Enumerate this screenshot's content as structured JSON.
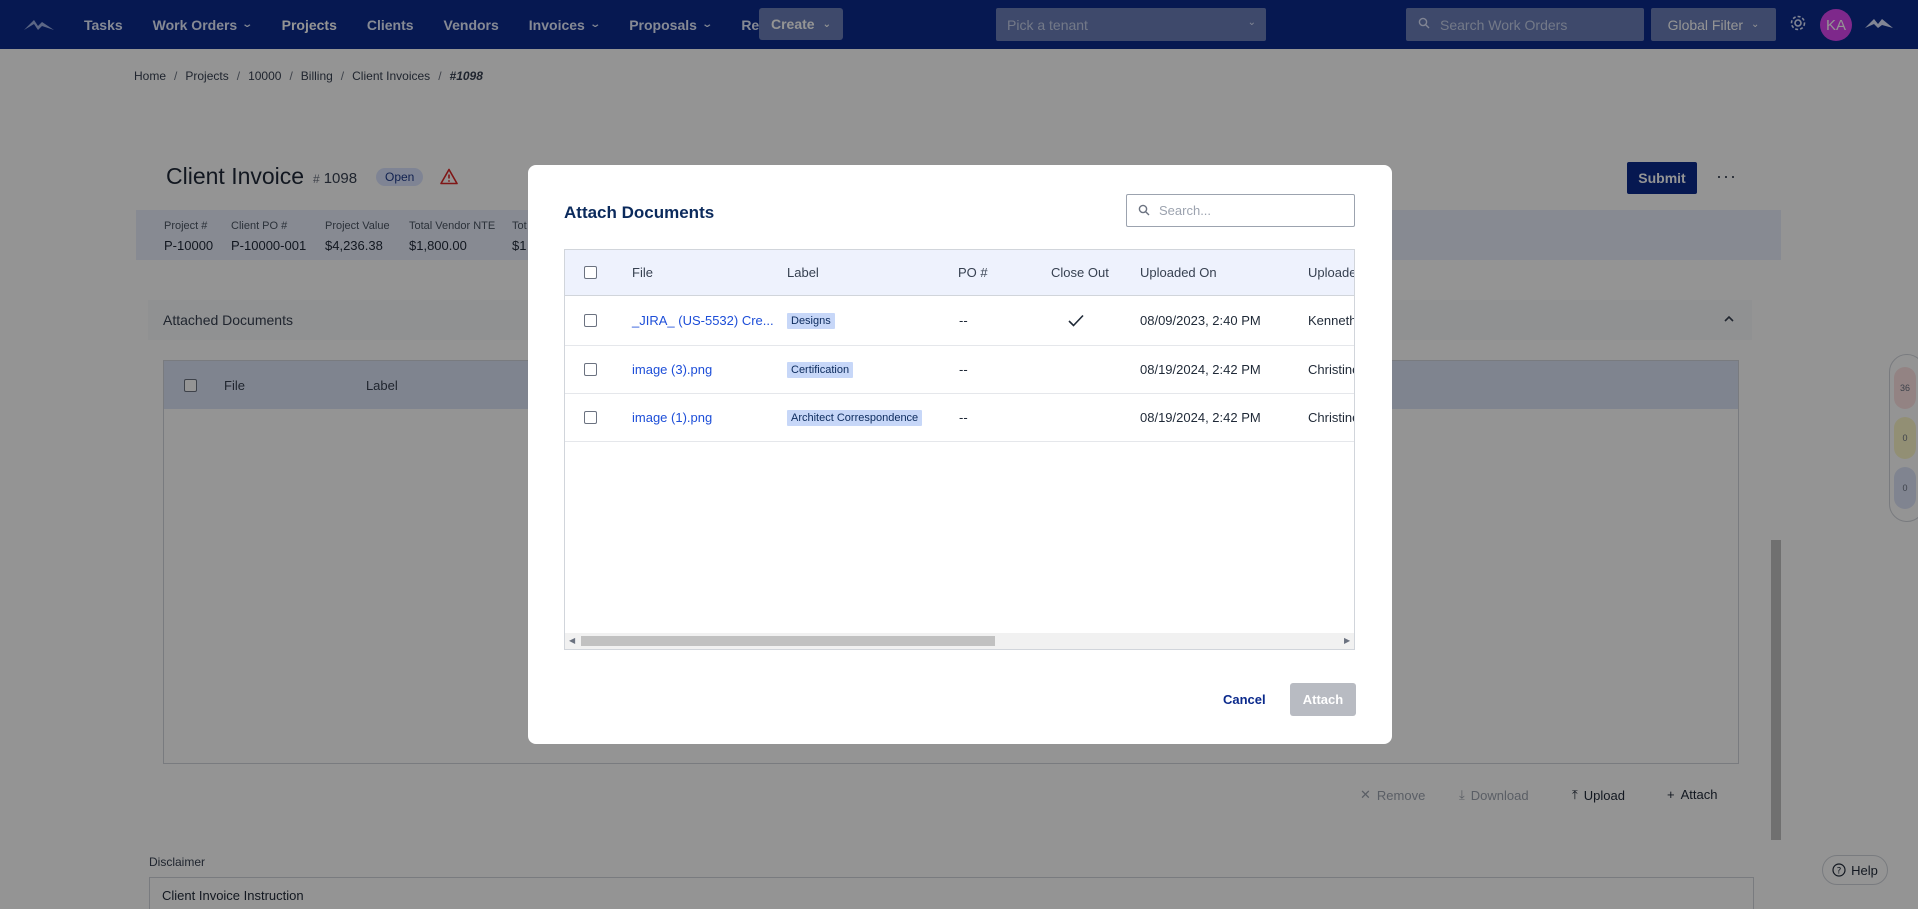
{
  "nav": {
    "items": [
      "Tasks",
      "Work Orders",
      "Projects",
      "Clients",
      "Vendors",
      "Invoices",
      "Proposals",
      "Reports"
    ],
    "create_label": "Create",
    "tenant_placeholder": "Pick a tenant",
    "search_placeholder": "Search Work Orders",
    "global_filter_label": "Global Filter",
    "avatar_initials": "KA"
  },
  "breadcrumb": [
    "Home",
    "Projects",
    "10000",
    "Billing",
    "Client Invoices",
    "#1098"
  ],
  "invoice": {
    "title": "Client Invoice",
    "hash": "#",
    "number": "1098",
    "status": "Open",
    "submit_label": "Submit",
    "more_label": "···"
  },
  "summary": [
    {
      "label": "Project #",
      "value": "P-10000"
    },
    {
      "label": "Client PO #",
      "value": "P-10000-001"
    },
    {
      "label": "Project Value",
      "value": "$4,236.38"
    },
    {
      "label": "Total Vendor NTE",
      "value": "$1,800.00"
    },
    {
      "label": "Tot",
      "value": "$1"
    }
  ],
  "attached": {
    "section_title": "Attached Documents",
    "columns": [
      "File",
      "Label"
    ],
    "actions": {
      "remove": "Remove",
      "download": "Download",
      "upload": "Upload",
      "attach": "Attach"
    }
  },
  "disclaimer": {
    "label": "Disclaimer",
    "value": "Client Invoice Instruction"
  },
  "help_label": "Help",
  "side_widget": [
    "36",
    "0",
    "0"
  ],
  "modal": {
    "title": "Attach Documents",
    "search_placeholder": "Search...",
    "columns": [
      "File",
      "Label",
      "PO #",
      "Close Out",
      "Uploaded On",
      "Uploade"
    ],
    "rows": [
      {
        "file": "_JIRA_ (US-5532) Cre...",
        "label": "Designs",
        "po": "--",
        "close_out": true,
        "uploaded_on": "08/09/2023, 2:40 PM",
        "uploaded_by": "Kenneth"
      },
      {
        "file": "image (3).png",
        "label": "Certification",
        "po": "--",
        "close_out": false,
        "uploaded_on": "08/19/2024, 2:42 PM",
        "uploaded_by": "Christine"
      },
      {
        "file": "image (1).png",
        "label": "Architect Correspondence",
        "po": "--",
        "close_out": false,
        "uploaded_on": "08/19/2024, 2:42 PM",
        "uploaded_by": "Christine"
      }
    ],
    "cancel_label": "Cancel",
    "attach_label": "Attach"
  },
  "colors": {
    "nav_bg": "#0b2a8c",
    "accent": "#0b2a8c",
    "avatar": "#d946ef",
    "tag_bg": "#c7d7f8"
  }
}
